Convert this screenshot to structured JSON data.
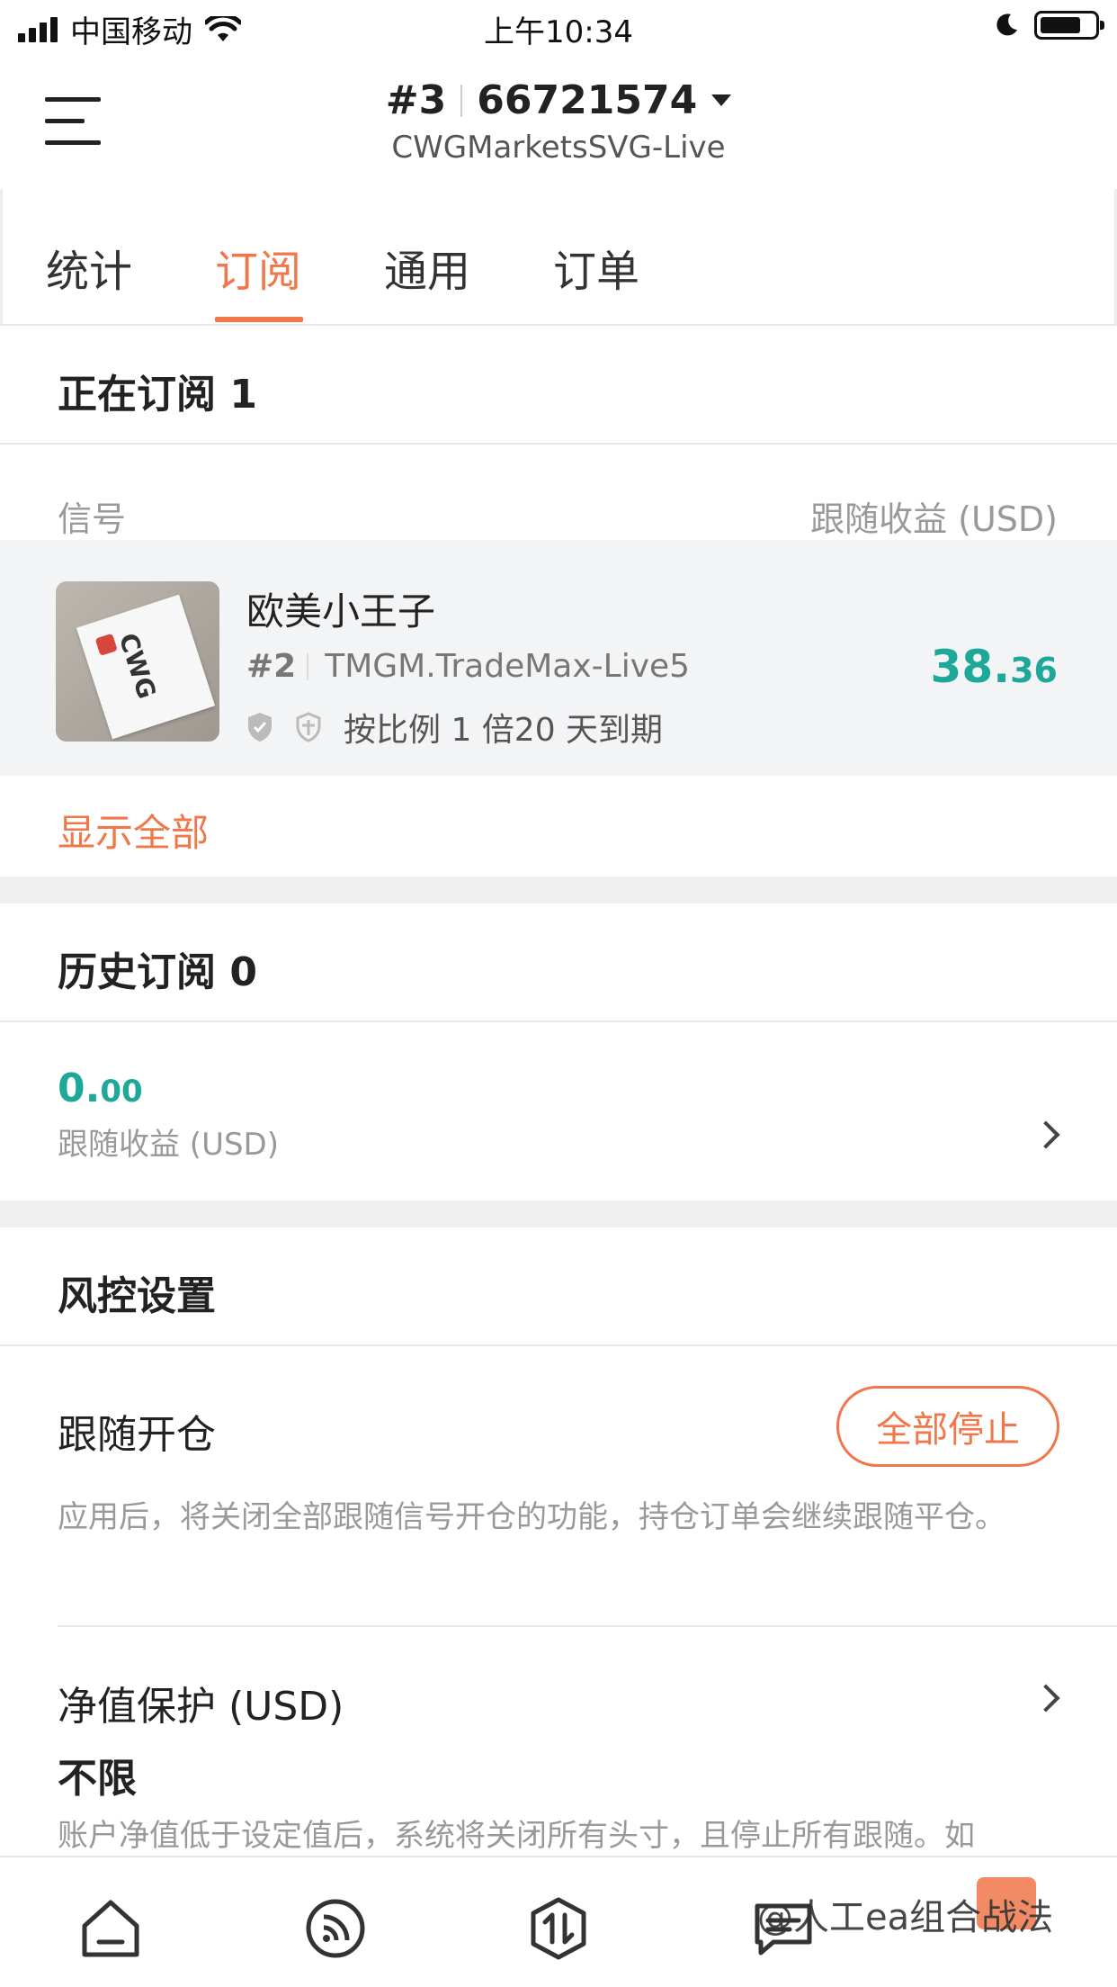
{
  "status_bar": {
    "carrier": "中国移动",
    "time": "上午10:34"
  },
  "header": {
    "account_index": "#3",
    "account_number": "66721574",
    "server": "CWGMarketsSVG-Live"
  },
  "tabs": [
    {
      "label": "统计",
      "active": false
    },
    {
      "label": "订阅",
      "active": true
    },
    {
      "label": "通用",
      "active": false
    },
    {
      "label": "订单",
      "active": false
    }
  ],
  "current_subscriptions": {
    "title": "正在订阅 1",
    "col_signal": "信号",
    "col_profit": "跟随收益 (USD)",
    "items": [
      {
        "avatar_text": "CWG",
        "name": "欧美小王子",
        "index": "#2",
        "server": "TMGM.TradeMax-Live5",
        "meta": "按比例 1 倍20 天到期",
        "profit_int": "38.",
        "profit_dec": "36"
      }
    ],
    "show_all": "显示全部"
  },
  "history_subscriptions": {
    "title": "历史订阅 0",
    "profit_int": "0.",
    "profit_dec": "00",
    "profit_label": "跟随收益 (USD)"
  },
  "risk_settings": {
    "title": "风控设置",
    "follow_open": {
      "label": "跟随开仓",
      "button": "全部停止",
      "desc": "应用后，将关闭全部跟随信号开仓的功能，持仓订单会继续跟随平仓。"
    },
    "equity_protection": {
      "label": "净值保护 (USD)",
      "value": "不限",
      "desc": "账户净值低于设定值后，系统将关闭所有头寸，且停止所有跟随。如"
    }
  },
  "bottom_nav": [
    {
      "icon": "home-icon"
    },
    {
      "icon": "signal-feed-icon"
    },
    {
      "icon": "trade-icon"
    },
    {
      "icon": "message-icon"
    }
  ],
  "watermark": "@人工ea组合战法",
  "colors": {
    "accent": "#f0774a",
    "profit": "#1ea89a"
  }
}
